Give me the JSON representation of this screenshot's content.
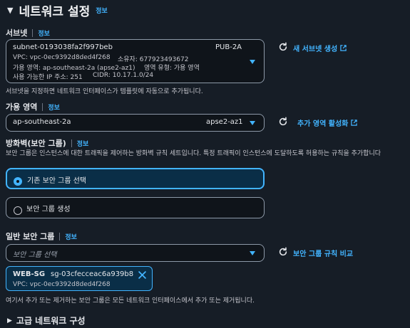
{
  "header": {
    "title": "네트워크 설정",
    "info": "정보"
  },
  "subnet": {
    "label": "서브넷",
    "info": "정보",
    "id": "subnet-0193038fa2f997beb",
    "name": "PUB-2A",
    "vpc_line": "VPC: vpc-0ec9392d8ded4f268",
    "owner_line": "소유자: 677923493672",
    "az_line": "가용 영역: ap-southeast-2a (apse2-az1)",
    "type_line": "영역 유형: 가용 영역",
    "ip_line": "사용 가능한 IP 주소: 251",
    "cidr_line": "CIDR: 10.17.1.0/24",
    "create_link": "새 서브넷 생성",
    "help": "서브넷을 지정하면 네트워크 인터페이스가 템플릿에 자동으로 추가됩니다."
  },
  "availability_zone": {
    "label": "가용 영역",
    "info": "정보",
    "value": "ap-southeast-2a",
    "zone_id": "apse2-az1",
    "enable_link": "추가 영역 활성화"
  },
  "firewall": {
    "label": "방화벽(보안 그룹)",
    "info": "정보",
    "description": "보안 그룹은 인스턴스에 대한 트래픽을 제어하는 방화벽 규칙 세트입니다. 특정 트래픽이 인스턴스에 도달하도록 허용하는 규칙을 추가합니다",
    "options": [
      {
        "label": "기존 보안 그룹 선택",
        "selected": true
      },
      {
        "label": "보안 그룹 생성",
        "selected": false
      }
    ]
  },
  "common_sg": {
    "label": "일반 보안 그룹",
    "info": "정보",
    "placeholder": "보안 그룹 선택",
    "compare_link": "보안 그룹 규칙 비교",
    "token": {
      "name": "WEB-SG",
      "id": "sg-03cfecceac6a939b8",
      "vpc": "VPC: vpc-0ec9392d8ded4f268"
    },
    "help": "여기서 추가 또는 제거하는 보안 그룹은 모든 네트워크 인터페이스에서 추가 또는 제거됩니다."
  },
  "advanced": {
    "label": "고급 네트워크 구성"
  },
  "colors": {
    "background": "#161d26",
    "accent": "#42b4ff",
    "input_bg": "#0f141a",
    "token_bg": "#0a2e47"
  },
  "icons": [
    "collapse-triangle-icon",
    "refresh-icon",
    "external-link-icon",
    "caret-down-icon",
    "close-icon",
    "expand-triangle-icon"
  ]
}
